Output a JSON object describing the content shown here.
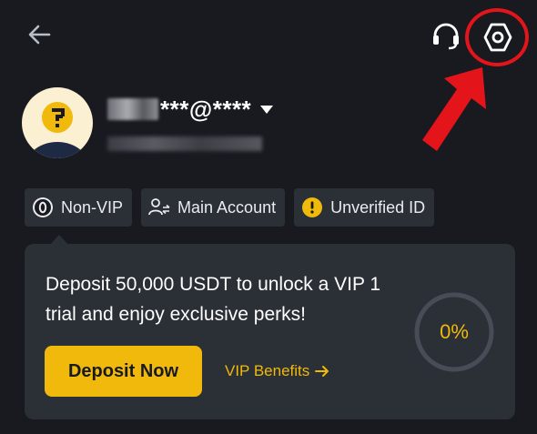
{
  "header": {
    "back_icon": "arrow-left-icon",
    "support_icon": "headset-icon",
    "settings_icon": "hexagon-settings-icon"
  },
  "profile": {
    "email_visible": "***@****",
    "avatar_icon": "question-mark-avatar"
  },
  "tags": [
    {
      "label": "Non-VIP",
      "icon": "vip-zero-icon"
    },
    {
      "label": "Main Account",
      "icon": "account-switch-icon"
    },
    {
      "label": "Unverified ID",
      "icon": "warning-icon"
    }
  ],
  "promo": {
    "text": "Deposit 50,000 USDT to unlock a VIP 1 trial and enjoy exclusive perks!",
    "deposit_label": "Deposit Now",
    "benefits_label": "VIP Benefits",
    "progress_label": "0%",
    "progress_value": 0
  },
  "colors": {
    "background": "#181a20",
    "card": "#2b2f36",
    "accent": "#f0b90b",
    "annotation_red": "#e4141b"
  }
}
